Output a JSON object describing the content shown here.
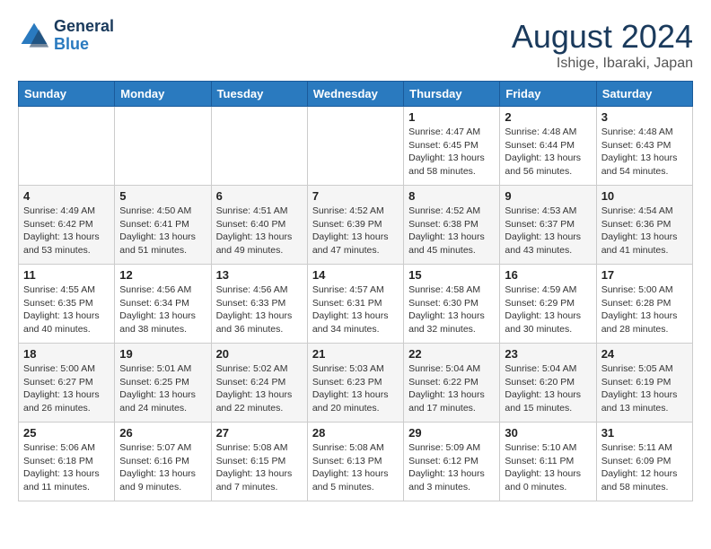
{
  "header": {
    "logo_line1": "General",
    "logo_line2": "Blue",
    "month": "August 2024",
    "location": "Ishige, Ibaraki, Japan"
  },
  "weekdays": [
    "Sunday",
    "Monday",
    "Tuesday",
    "Wednesday",
    "Thursday",
    "Friday",
    "Saturday"
  ],
  "weeks": [
    [
      {
        "day": "",
        "detail": ""
      },
      {
        "day": "",
        "detail": ""
      },
      {
        "day": "",
        "detail": ""
      },
      {
        "day": "",
        "detail": ""
      },
      {
        "day": "1",
        "detail": "Sunrise: 4:47 AM\nSunset: 6:45 PM\nDaylight: 13 hours\nand 58 minutes."
      },
      {
        "day": "2",
        "detail": "Sunrise: 4:48 AM\nSunset: 6:44 PM\nDaylight: 13 hours\nand 56 minutes."
      },
      {
        "day": "3",
        "detail": "Sunrise: 4:48 AM\nSunset: 6:43 PM\nDaylight: 13 hours\nand 54 minutes."
      }
    ],
    [
      {
        "day": "4",
        "detail": "Sunrise: 4:49 AM\nSunset: 6:42 PM\nDaylight: 13 hours\nand 53 minutes."
      },
      {
        "day": "5",
        "detail": "Sunrise: 4:50 AM\nSunset: 6:41 PM\nDaylight: 13 hours\nand 51 minutes."
      },
      {
        "day": "6",
        "detail": "Sunrise: 4:51 AM\nSunset: 6:40 PM\nDaylight: 13 hours\nand 49 minutes."
      },
      {
        "day": "7",
        "detail": "Sunrise: 4:52 AM\nSunset: 6:39 PM\nDaylight: 13 hours\nand 47 minutes."
      },
      {
        "day": "8",
        "detail": "Sunrise: 4:52 AM\nSunset: 6:38 PM\nDaylight: 13 hours\nand 45 minutes."
      },
      {
        "day": "9",
        "detail": "Sunrise: 4:53 AM\nSunset: 6:37 PM\nDaylight: 13 hours\nand 43 minutes."
      },
      {
        "day": "10",
        "detail": "Sunrise: 4:54 AM\nSunset: 6:36 PM\nDaylight: 13 hours\nand 41 minutes."
      }
    ],
    [
      {
        "day": "11",
        "detail": "Sunrise: 4:55 AM\nSunset: 6:35 PM\nDaylight: 13 hours\nand 40 minutes."
      },
      {
        "day": "12",
        "detail": "Sunrise: 4:56 AM\nSunset: 6:34 PM\nDaylight: 13 hours\nand 38 minutes."
      },
      {
        "day": "13",
        "detail": "Sunrise: 4:56 AM\nSunset: 6:33 PM\nDaylight: 13 hours\nand 36 minutes."
      },
      {
        "day": "14",
        "detail": "Sunrise: 4:57 AM\nSunset: 6:31 PM\nDaylight: 13 hours\nand 34 minutes."
      },
      {
        "day": "15",
        "detail": "Sunrise: 4:58 AM\nSunset: 6:30 PM\nDaylight: 13 hours\nand 32 minutes."
      },
      {
        "day": "16",
        "detail": "Sunrise: 4:59 AM\nSunset: 6:29 PM\nDaylight: 13 hours\nand 30 minutes."
      },
      {
        "day": "17",
        "detail": "Sunrise: 5:00 AM\nSunset: 6:28 PM\nDaylight: 13 hours\nand 28 minutes."
      }
    ],
    [
      {
        "day": "18",
        "detail": "Sunrise: 5:00 AM\nSunset: 6:27 PM\nDaylight: 13 hours\nand 26 minutes."
      },
      {
        "day": "19",
        "detail": "Sunrise: 5:01 AM\nSunset: 6:25 PM\nDaylight: 13 hours\nand 24 minutes."
      },
      {
        "day": "20",
        "detail": "Sunrise: 5:02 AM\nSunset: 6:24 PM\nDaylight: 13 hours\nand 22 minutes."
      },
      {
        "day": "21",
        "detail": "Sunrise: 5:03 AM\nSunset: 6:23 PM\nDaylight: 13 hours\nand 20 minutes."
      },
      {
        "day": "22",
        "detail": "Sunrise: 5:04 AM\nSunset: 6:22 PM\nDaylight: 13 hours\nand 17 minutes."
      },
      {
        "day": "23",
        "detail": "Sunrise: 5:04 AM\nSunset: 6:20 PM\nDaylight: 13 hours\nand 15 minutes."
      },
      {
        "day": "24",
        "detail": "Sunrise: 5:05 AM\nSunset: 6:19 PM\nDaylight: 13 hours\nand 13 minutes."
      }
    ],
    [
      {
        "day": "25",
        "detail": "Sunrise: 5:06 AM\nSunset: 6:18 PM\nDaylight: 13 hours\nand 11 minutes."
      },
      {
        "day": "26",
        "detail": "Sunrise: 5:07 AM\nSunset: 6:16 PM\nDaylight: 13 hours\nand 9 minutes."
      },
      {
        "day": "27",
        "detail": "Sunrise: 5:08 AM\nSunset: 6:15 PM\nDaylight: 13 hours\nand 7 minutes."
      },
      {
        "day": "28",
        "detail": "Sunrise: 5:08 AM\nSunset: 6:13 PM\nDaylight: 13 hours\nand 5 minutes."
      },
      {
        "day": "29",
        "detail": "Sunrise: 5:09 AM\nSunset: 6:12 PM\nDaylight: 13 hours\nand 3 minutes."
      },
      {
        "day": "30",
        "detail": "Sunrise: 5:10 AM\nSunset: 6:11 PM\nDaylight: 13 hours\nand 0 minutes."
      },
      {
        "day": "31",
        "detail": "Sunrise: 5:11 AM\nSunset: 6:09 PM\nDaylight: 12 hours\nand 58 minutes."
      }
    ]
  ]
}
